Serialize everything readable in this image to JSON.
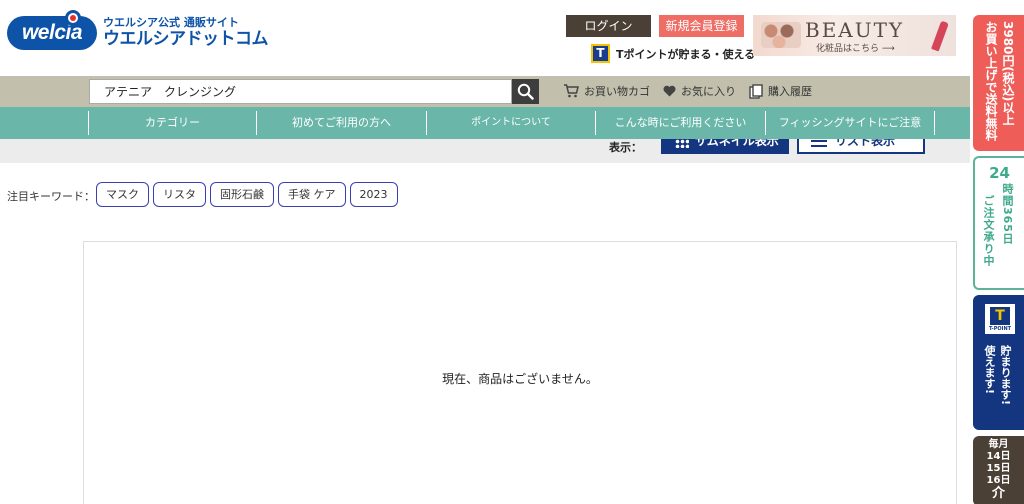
{
  "header": {
    "logo_text": "welcia",
    "logo_sub": "ウエルシア公式 通販サイト",
    "logo_main": "ウエルシアドットコム",
    "login_label": "ログイン",
    "register_label": "新規会員登録",
    "tpoint_text": "Tポイントが貯まる・使える",
    "banner_title": "BEAUTY",
    "banner_sub": "化粧品はこちら ⟶"
  },
  "search": {
    "value": "アテニア　クレンジング",
    "cart_label": "お買い物カゴ",
    "favorites_label": "お気に入り",
    "history_label": "購入履歴"
  },
  "nav": {
    "items": [
      "カテゴリー",
      "初めてご利用の方へ",
      "ポイントについて",
      "こんな時にご利用ください",
      "フィッシングサイトにご注意"
    ]
  },
  "display": {
    "label": "表示：",
    "thumbnail_label": "サムネイル表示",
    "list_label": "リスト表示"
  },
  "keywords": {
    "label": "注目キーワード：",
    "items": [
      "マスク",
      "リスタ",
      "固形石鹸",
      "手袋 ケア",
      "2023"
    ]
  },
  "results": {
    "empty_message": "現在、商品はございません。"
  },
  "sidebar": {
    "shipping_col1": "3980円(税込)以上",
    "shipping_col2": "お買い上げで送料無料",
    "order_num": "24",
    "order_col1": "時間365日",
    "order_col2": "ご注文承り中",
    "tpoint_logo": "T",
    "tpoint_logo_sub": "T-POINT",
    "tpoint_col1": "貯まります!",
    "tpoint_col2": "使えます!",
    "days_l1": "毎月",
    "days_l2": "14日",
    "days_l3": "15日",
    "days_l4": "16日",
    "days_l5": "介"
  },
  "colors": {
    "brand_blue": "#0d53a8",
    "nav_teal": "#6ab7aa",
    "search_bg": "#c2bfac",
    "register_red": "#ee6e66",
    "tpoint_navy": "#14357f"
  }
}
